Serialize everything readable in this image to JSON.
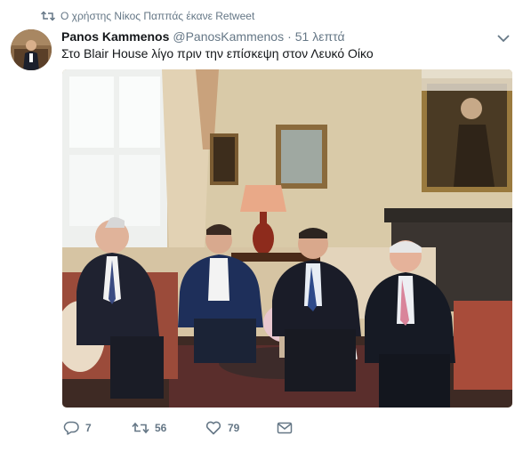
{
  "retweet_context": {
    "text": "Ο χρήστης Νίκος Παππάς έκανε Retweet",
    "icon": "retweet-icon"
  },
  "tweet": {
    "fullname": "Panos Kammenos",
    "username": "@PanosKammenos",
    "separator": "·",
    "time": "51 λεπτά",
    "text": "Στο Blair House λίγο πριν την επίσκεψη στον Λευκό Οίκο",
    "caret_icon": "chevron-down-icon"
  },
  "actions": {
    "reply": {
      "icon": "reply-icon",
      "count": "7"
    },
    "retweet": {
      "icon": "retweet-icon",
      "count": "56"
    },
    "like": {
      "icon": "heart-icon",
      "count": "79"
    },
    "message": {
      "icon": "envelope-icon"
    }
  },
  "colors": {
    "secondary_text": "#657786",
    "primary_text": "#14171a"
  }
}
